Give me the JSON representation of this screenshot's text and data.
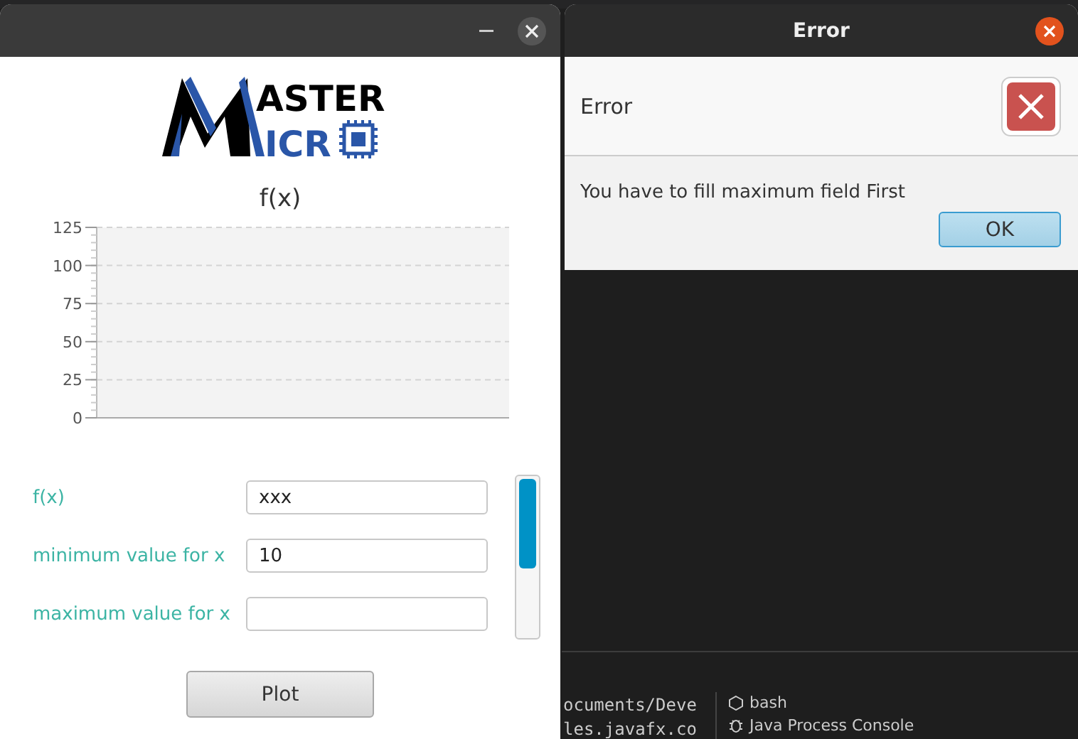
{
  "terminal": {
    "lines": [
      "ocuments/Deve",
      "les.javafx.co"
    ]
  },
  "terminal_tabs": [
    {
      "label": "bash",
      "kind": "shell"
    },
    {
      "label": "Java Process Console",
      "kind": "console"
    }
  ],
  "main_window": {
    "logo": {
      "line_1": "ASTER",
      "line_2": "ICR"
    },
    "chart": {
      "title": "f(x)",
      "y_tick_labels": [
        "125",
        "100",
        "75",
        "50",
        "25",
        "0"
      ]
    },
    "fields": [
      {
        "label": "f(x)",
        "value": "xxx"
      },
      {
        "label": "minimum value for x",
        "value": "10"
      },
      {
        "label": "maximum value for x"
      }
    ],
    "plot_button": "Plot"
  },
  "error_dialog": {
    "title": "Error",
    "header": "Error",
    "message": "You have to fill maximum field First",
    "ok_button": "OK"
  }
}
